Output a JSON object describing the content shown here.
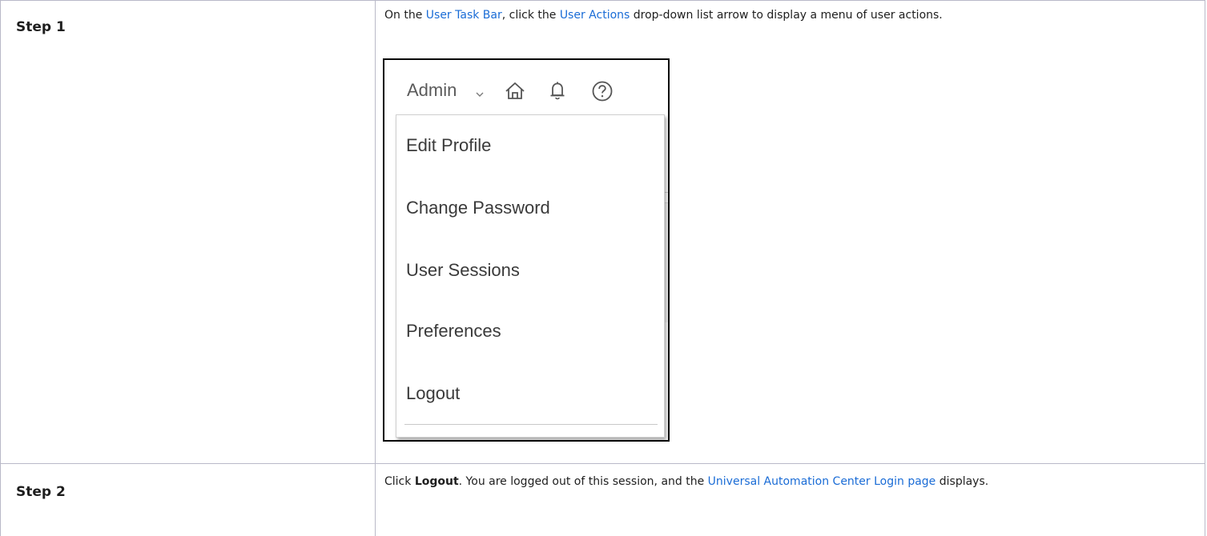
{
  "steps": [
    {
      "label": "Step 1",
      "text_before_link1": "On the ",
      "link1": "User Task Bar",
      "text_between": ", click the ",
      "link2": "User Actions",
      "text_after": " drop-down list arrow to display a menu of user actions."
    },
    {
      "label": "Step  2",
      "text_before_bold": "Click ",
      "bold": "Logout",
      "text_middle": ". You are logged out of this session, and the ",
      "link": "Universal Automation Center Login page",
      "text_after": " displays."
    }
  ],
  "figure": {
    "user_name": "Admin",
    "icons": [
      "chevron-down-icon",
      "home-icon",
      "bell-icon",
      "help-icon"
    ],
    "menu_items": [
      "Edit Profile",
      "Change Password",
      "User Sessions",
      "Preferences",
      "Logout"
    ]
  },
  "colors": {
    "link": "#1a6cd6",
    "border": "#b9b9c8"
  }
}
